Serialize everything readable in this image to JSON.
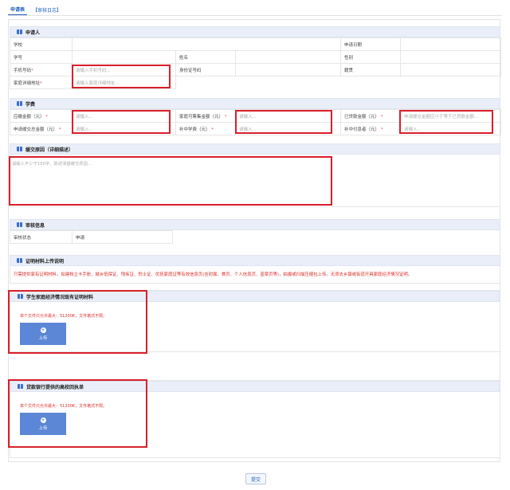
{
  "tabs": {
    "active": "申请表",
    "other": "【审核日志】"
  },
  "applicant": {
    "title": "申请人",
    "school": "学校",
    "apply_date": "申请日期",
    "student_id": "学号",
    "name": "姓名",
    "gender": "性别",
    "phone": "手机号码",
    "phone_ph": "请输入手机号码...",
    "id_card": "身份证号码",
    "household": "籍贯",
    "address": "家庭详细地址",
    "address_ph": "请输入家庭详细地址..."
  },
  "tuition": {
    "title": "学费",
    "should_pay": "应缴金额（元）",
    "loan_amount": "家庭可筹集金额（元）",
    "paid": "已贷款金额（元）",
    "apply_defer": "申请缓交总金额（元）",
    "grade": "补中学费（元）",
    "interest": "补中付息者（元）",
    "ph": "请输入...",
    "paid_ph": "申请缓交金额应小于等于已贷款金额..."
  },
  "reason": {
    "title": "缓交原因（详细描述）",
    "ph": "请输入不少于150字、陈述清楚缓交原因..."
  },
  "review": {
    "title": "审核信息",
    "status_label": "审核状态",
    "status_value": "申请"
  },
  "materials": {
    "title": "证明材料上传说明",
    "notice": "只需提供家有证明材料，如建档立卡手册、城乡低保证、残疾证、烈士证、优抚家庭证等有效信息页(含封面、首页、个人信息页、盖章页等)，拍摄或扫描压缩包上传。无须去乡镇或街道开具家庭经济情况证明。"
  },
  "upload1": {
    "title": "学生家庭经济情况既有证明材料",
    "hint": "单个文件只允许最大：51200K，文件格式不限。",
    "btn": "上传"
  },
  "upload2": {
    "title": "贷款银行提供的高校回执单",
    "hint": "单个文件只允许最大：51200K，文件格式不限。",
    "btn": "上传"
  },
  "submit": "提交"
}
